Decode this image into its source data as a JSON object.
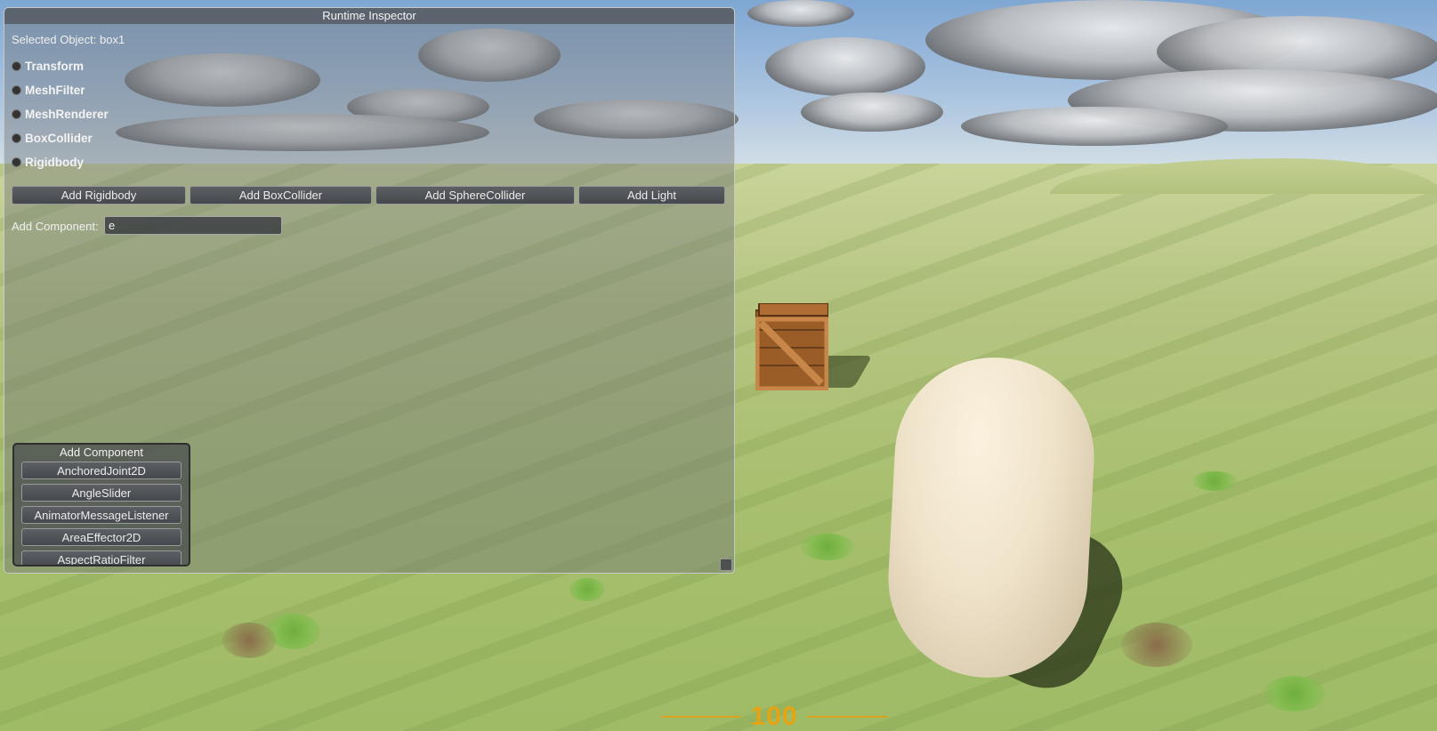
{
  "window": {
    "title": "Runtime Inspector",
    "selected_label": "Selected Object: box1"
  },
  "components": [
    {
      "label": "Transform"
    },
    {
      "label": "MeshFilter"
    },
    {
      "label": "MeshRenderer"
    },
    {
      "label": "BoxCollider"
    },
    {
      "label": "Rigidbody"
    }
  ],
  "buttons": {
    "add_rigidbody": "Add Rigidbody",
    "add_boxcollider": "Add BoxCollider",
    "add_spherecollider": "Add SphereCollider",
    "add_light": "Add Light"
  },
  "add_component": {
    "label": "Add Component:",
    "value": "e"
  },
  "popup": {
    "title": "Add Component",
    "items": [
      "AnchoredJoint2D",
      "AngleSlider",
      "AnimatorMessageListener",
      "AreaEffector2D",
      "AspectRatioFilter"
    ]
  },
  "hud": {
    "health": "100",
    "color": "#e5a414"
  }
}
